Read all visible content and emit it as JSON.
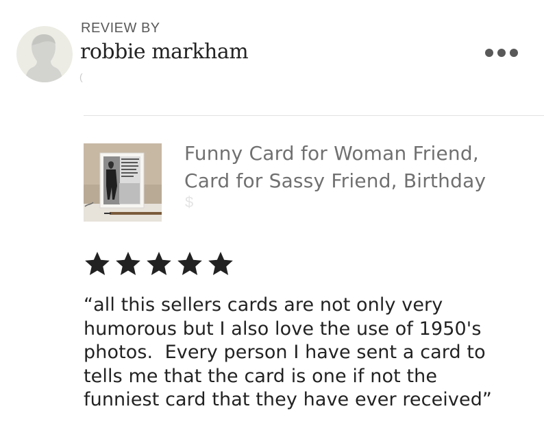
{
  "review": {
    "header_label": "REVIEW BY",
    "reviewer_name": "robbie markham",
    "date_partial": "(",
    "rating": 5,
    "rating_max": 5,
    "text_lines": [
      "“all this sellers cards are not only very",
      "humorous but I also love the use of 1950's",
      "photos.  Every person I have sent a card to",
      "tells me that the card is one if not the",
      "funniest card that they have ever received”"
    ]
  },
  "listing": {
    "title_lines": [
      "Funny Card for Woman Friend,",
      "Card for Sassy Friend, Birthday"
    ],
    "price_partial": "$"
  },
  "icons": {
    "avatar": "default-user-avatar-icon",
    "more": "more-options-icon",
    "star": "star-filled-icon"
  },
  "colors": {
    "star": "#222222",
    "title_gray": "#707070",
    "avatar_bg": "#ecece4"
  }
}
